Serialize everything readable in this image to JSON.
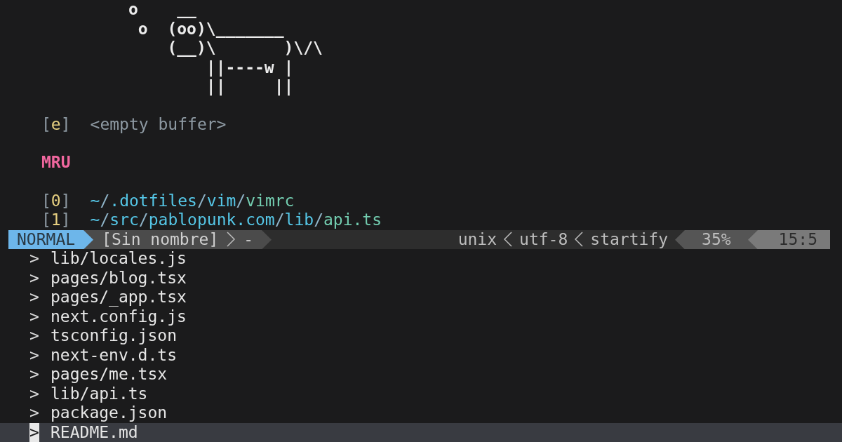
{
  "cow_art": [
    "             o    __",
    "              o  (oo)\\_______",
    "                 (__)\\       )\\/\\",
    "                     ||----w |",
    "                     ||     ||"
  ],
  "empty_buffer": {
    "key": "[e]",
    "label": "<empty buffer>"
  },
  "mru": {
    "title": "MRU",
    "items": [
      {
        "key": "[0]",
        "path": "~/.dotfiles/vim/vimrc"
      },
      {
        "key": "[1]",
        "path": "~/src/pablopunk.com/lib/api.ts"
      }
    ]
  },
  "status_bar": {
    "mode": "NORMAL",
    "file": "[Sin nombre]",
    "modified": "-",
    "format": "unix",
    "encoding": "utf-8",
    "filetype": "startify",
    "percent": "35%",
    "position": "15:5"
  },
  "finder": {
    "results": [
      {
        "prompt": ">",
        "path": "lib/locales.js",
        "selected": false
      },
      {
        "prompt": ">",
        "path": "pages/blog.tsx",
        "selected": false
      },
      {
        "prompt": ">",
        "path": "pages/_app.tsx",
        "selected": false
      },
      {
        "prompt": ">",
        "path": "next.config.js",
        "selected": false
      },
      {
        "prompt": ">",
        "path": "tsconfig.json",
        "selected": false
      },
      {
        "prompt": ">",
        "path": "next-env.d.ts",
        "selected": false
      },
      {
        "prompt": ">",
        "path": "pages/me.tsx",
        "selected": false
      },
      {
        "prompt": ">",
        "path": "lib/api.ts",
        "selected": false
      },
      {
        "prompt": ">",
        "path": "package.json",
        "selected": false
      },
      {
        "prompt": ">",
        "path": "README.md",
        "selected": true
      }
    ]
  }
}
